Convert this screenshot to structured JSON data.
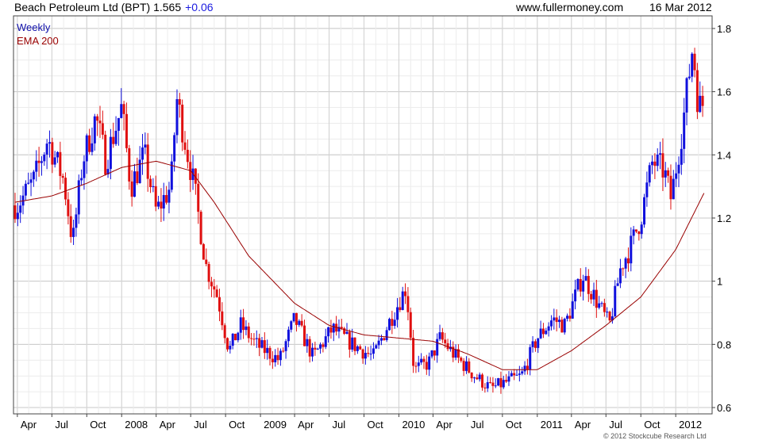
{
  "header": {
    "title": "Beach Petroleum Ltd (BPT) 1.565",
    "change": "+0.06",
    "source": "www.fullermoney.com",
    "date": "16 Mar 2012"
  },
  "copyright": "© 2012 Stockcube Research Ltd",
  "colors": {
    "up": "#1010dd",
    "down": "#e01010",
    "ema": "#990000",
    "grid": "#dcdcdc",
    "weekly_label": "#1010aa",
    "ema_label": "#990000"
  },
  "chart_data": {
    "type": "candlestick",
    "x_ticks": [
      "Apr",
      "Jul",
      "Oct",
      "2008",
      "Apr",
      "Jul",
      "Oct",
      "2009",
      "Apr",
      "Jul",
      "Oct",
      "2010",
      "Apr",
      "Jul",
      "Oct",
      "2011",
      "Apr",
      "Jul",
      "Oct",
      "2012"
    ],
    "y_ticks": [
      "0.6",
      "0.8",
      "1",
      "1.2",
      "1.4",
      "1.6",
      "1.8"
    ],
    "ylim": [
      0.58,
      1.84
    ],
    "xlim": [
      "2007-03-26",
      "2012-03-16"
    ],
    "legend": [
      "Weekly",
      "EMA 200"
    ],
    "weekly_close_anchors": [
      [
        "2007-04-01",
        1.24
      ],
      [
        "2007-05-15",
        1.32
      ],
      [
        "2007-06-20",
        1.45
      ],
      [
        "2007-08-01",
        1.32
      ],
      [
        "2007-08-25",
        1.12
      ],
      [
        "2007-09-20",
        1.38
      ],
      [
        "2007-10-25",
        1.52
      ],
      [
        "2007-11-20",
        1.38
      ],
      [
        "2008-01-01",
        1.55
      ],
      [
        "2008-01-25",
        1.3
      ],
      [
        "2008-03-01",
        1.4
      ],
      [
        "2008-04-01",
        1.22
      ],
      [
        "2008-05-10",
        1.3
      ],
      [
        "2008-05-25",
        1.58
      ],
      [
        "2008-07-10",
        1.3
      ],
      [
        "2008-08-10",
        1.05
      ],
      [
        "2008-09-10",
        0.95
      ],
      [
        "2008-10-10",
        0.78
      ],
      [
        "2008-11-10",
        0.86
      ],
      [
        "2008-12-20",
        0.8
      ],
      [
        "2009-02-20",
        0.75
      ],
      [
        "2009-04-01",
        0.88
      ],
      [
        "2009-05-20",
        0.76
      ],
      [
        "2009-07-10",
        0.85
      ],
      [
        "2009-09-01",
        0.8
      ],
      [
        "2009-10-25",
        0.76
      ],
      [
        "2009-12-10",
        0.88
      ],
      [
        "2010-01-20",
        0.98
      ],
      [
        "2010-02-10",
        0.72
      ],
      [
        "2010-03-20",
        0.74
      ],
      [
        "2010-04-20",
        0.82
      ],
      [
        "2010-06-01",
        0.76
      ],
      [
        "2010-07-20",
        0.7
      ],
      [
        "2010-09-01",
        0.66
      ],
      [
        "2010-10-10",
        0.68
      ],
      [
        "2010-11-20",
        0.7
      ],
      [
        "2011-01-01",
        0.82
      ],
      [
        "2011-02-10",
        0.88
      ],
      [
        "2011-03-15",
        0.86
      ],
      [
        "2011-05-01",
        1.02
      ],
      [
        "2011-06-01",
        0.95
      ],
      [
        "2011-07-10",
        0.86
      ],
      [
        "2011-08-10",
        1.05
      ],
      [
        "2011-09-01",
        1.1
      ],
      [
        "2011-10-01",
        1.2
      ],
      [
        "2011-11-01",
        1.38
      ],
      [
        "2011-12-01",
        1.35
      ],
      [
        "2011-12-20",
        1.26
      ],
      [
        "2012-01-20",
        1.5
      ],
      [
        "2012-02-15",
        1.75
      ],
      [
        "2012-03-01",
        1.55
      ],
      [
        "2012-03-16",
        1.565
      ]
    ],
    "ema_anchors": [
      [
        "2007-03-26",
        1.25
      ],
      [
        "2007-07-01",
        1.27
      ],
      [
        "2007-10-01",
        1.31
      ],
      [
        "2008-01-01",
        1.36
      ],
      [
        "2008-04-01",
        1.38
      ],
      [
        "2008-07-01",
        1.35
      ],
      [
        "2008-09-01",
        1.25
      ],
      [
        "2008-12-01",
        1.08
      ],
      [
        "2009-04-01",
        0.93
      ],
      [
        "2009-07-01",
        0.86
      ],
      [
        "2009-10-01",
        0.83
      ],
      [
        "2010-01-01",
        0.82
      ],
      [
        "2010-04-01",
        0.81
      ],
      [
        "2010-07-01",
        0.77
      ],
      [
        "2010-10-01",
        0.72
      ],
      [
        "2011-01-01",
        0.72
      ],
      [
        "2011-04-01",
        0.78
      ],
      [
        "2011-07-01",
        0.86
      ],
      [
        "2011-10-01",
        0.95
      ],
      [
        "2012-01-01",
        1.1
      ],
      [
        "2012-03-16",
        1.28
      ]
    ]
  }
}
